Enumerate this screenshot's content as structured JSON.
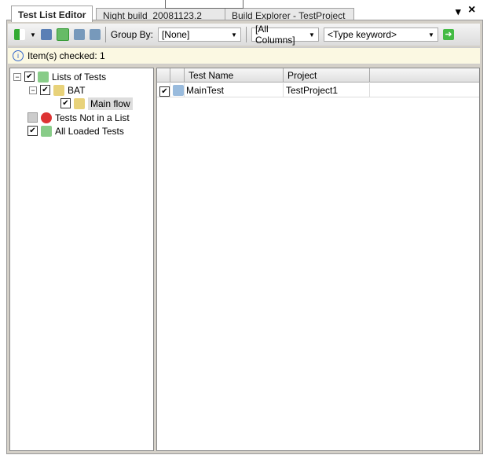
{
  "tabs": [
    {
      "label": "Test List Editor",
      "active": true
    },
    {
      "label": "Night build_20081123.2"
    },
    {
      "label": "Build Explorer - TestProject"
    }
  ],
  "window_controls": {
    "pin": "▾",
    "close": "×"
  },
  "toolbar": {
    "group_by_label": "Group By:",
    "group_by_value": "[None]",
    "columns_value": "[All Columns]",
    "keyword_placeholder": "<Type keyword>"
  },
  "info": {
    "text": "Item(s) checked: 1"
  },
  "tree": [
    {
      "label": "Lists of Tests",
      "checked": true,
      "expander": "−"
    },
    {
      "label": "BAT",
      "checked": true,
      "expander": "−"
    },
    {
      "label": "Main flow",
      "checked": true,
      "selected": true
    },
    {
      "label": "Tests Not in a List",
      "checked": false
    },
    {
      "label": "All Loaded Tests",
      "checked": true
    }
  ],
  "grid": {
    "columns": [
      "Test Name",
      "Project"
    ],
    "rows": [
      {
        "checked": true,
        "name": "MainTest",
        "project": "TestProject1"
      }
    ]
  }
}
